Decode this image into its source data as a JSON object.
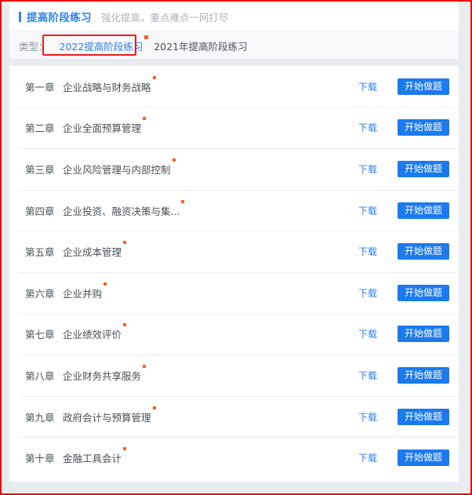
{
  "header": {
    "title": "提高阶段练习",
    "subtitle": "强化提高，重点难点一网打尽"
  },
  "filter": {
    "label": "类型：",
    "tabs": [
      {
        "label": "2022提高阶段练习",
        "active": true,
        "badge": true
      },
      {
        "label": "2021年提高阶段练习",
        "active": false,
        "badge": false
      }
    ]
  },
  "actions": {
    "download_label": "下载",
    "start_label": "开始做题"
  },
  "colors": {
    "accent_blue": "#2d7fe8",
    "button_blue": "#1a7aee",
    "badge_orange": "#f95a24",
    "annotation_red": "#ef1b1b",
    "page_background": "#e9ecee"
  },
  "chapters": [
    {
      "no": "第一章",
      "title": "企业战略与财务战略",
      "badge": true
    },
    {
      "no": "第二章",
      "title": "企业全面预算管理",
      "badge": true
    },
    {
      "no": "第三章",
      "title": "企业风险管理与内部控制",
      "badge": true
    },
    {
      "no": "第四章",
      "title": "企业投资、融资决策与集...",
      "badge": true
    },
    {
      "no": "第五章",
      "title": "企业成本管理",
      "badge": true
    },
    {
      "no": "第六章",
      "title": "企业并购",
      "badge": true
    },
    {
      "no": "第七章",
      "title": "企业绩效评价",
      "badge": true
    },
    {
      "no": "第八章",
      "title": "企业财务共享服务",
      "badge": true
    },
    {
      "no": "第九章",
      "title": "政府会计与预算管理",
      "badge": true
    },
    {
      "no": "第十章",
      "title": "金融工具会计",
      "badge": true
    }
  ]
}
